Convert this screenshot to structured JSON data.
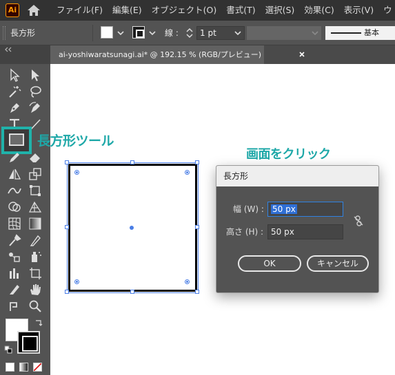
{
  "app": {
    "logo_text": "Ai"
  },
  "menu": {
    "items": [
      "ファイル(F)",
      "編集(E)",
      "オブジェクト(O)",
      "書式(T)",
      "選択(S)",
      "効果(C)",
      "表示(V)",
      "ウ"
    ]
  },
  "control_bar": {
    "tool_name": "長方形",
    "stroke_label": "線 :",
    "stroke_weight": "1 pt",
    "brush_name": "基本"
  },
  "document_tab": {
    "title": "ai-yoshiwaratsunagi.ai* @ 192.15 % (RGB/プレビュー)"
  },
  "annotations": {
    "tool_callout": "長方形ツール",
    "canvas_callout": "画面をクリック"
  },
  "dialog": {
    "title": "長方形",
    "width_label": "幅 (W) :",
    "width_value": "50 px",
    "height_label": "高さ (H) :",
    "height_value": "50 px",
    "ok_label": "OK",
    "cancel_label": "キャンセル"
  },
  "colors": {
    "accent_teal": "#1ea8a8",
    "selection_blue": "#4a7ee6",
    "ui_dark": "#535353",
    "menubar": "#323232"
  },
  "icons": [
    "home-icon",
    "selection-tool-icon",
    "direct-selection-tool-icon",
    "magic-wand-icon",
    "lasso-icon",
    "pen-tool-icon",
    "curvature-tool-icon",
    "type-tool-icon",
    "line-tool-icon",
    "rectangle-tool-icon",
    "eraser-icon",
    "rotate-icon",
    "scale-icon",
    "width-tool-icon",
    "free-transform-icon",
    "shape-builder-icon",
    "perspective-grid-icon",
    "mesh-icon",
    "gradient-icon",
    "eyedropper-icon",
    "blend-icon",
    "symbol-sprayer-icon",
    "column-graph-icon",
    "artboard-icon",
    "slice-icon",
    "hand-icon",
    "zoom-icon",
    "link-icon",
    "close-icon"
  ]
}
